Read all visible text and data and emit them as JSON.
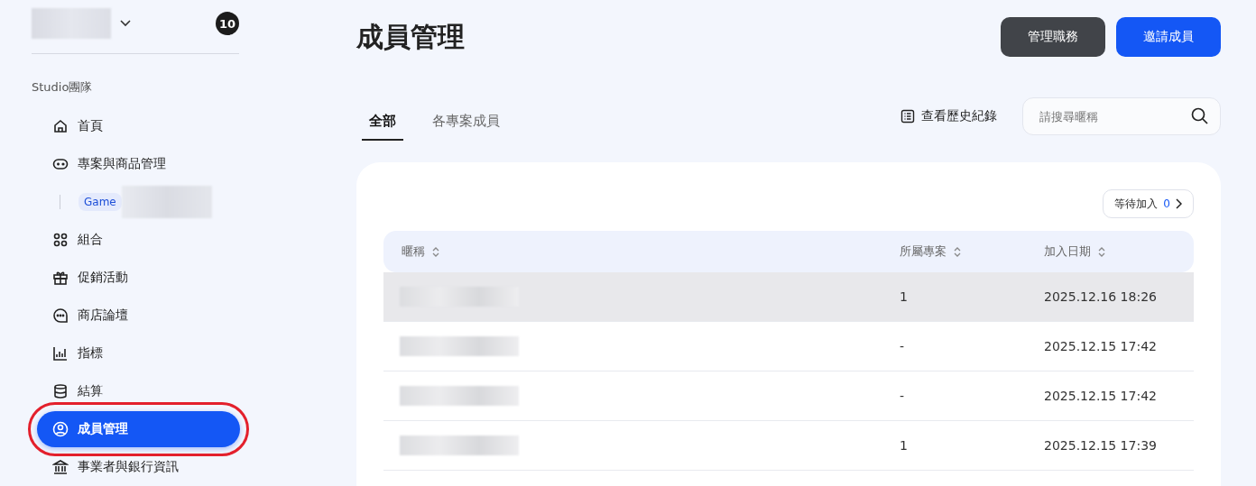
{
  "sidebar": {
    "notification_count": "10",
    "section_label": "Studio團隊",
    "items": [
      {
        "label": "首頁",
        "selected": false
      },
      {
        "label": "專案與商品管理",
        "selected": false,
        "children": [
          {
            "label": "Game",
            "selected": false
          }
        ]
      },
      {
        "label": "組合",
        "selected": false
      },
      {
        "label": "促銷活動",
        "selected": false
      },
      {
        "label": "商店論壇",
        "selected": false
      },
      {
        "label": "指標",
        "selected": false
      },
      {
        "label": "結算",
        "selected": false
      },
      {
        "label": "成員管理",
        "selected": true
      },
      {
        "label": "事業者與銀行資訊",
        "selected": false
      }
    ]
  },
  "page_title": "成員管理",
  "header_buttons": [
    {
      "label": "管理職務",
      "kind": "dark"
    },
    {
      "label": "邀請成員",
      "kind": "primary"
    }
  ],
  "tabs": [
    {
      "label": "全部",
      "selected": true
    },
    {
      "label": "各專案成員",
      "selected": false
    }
  ],
  "history_link": "查看歷史紀錄",
  "search": {
    "placeholder": "請搜尋暱稱"
  },
  "pending": {
    "label": "等待加入",
    "count": "0"
  },
  "table": {
    "columns": [
      "暱稱",
      "所屬專案",
      "加入日期"
    ],
    "rows": [
      {
        "project": "1",
        "date": "2025.12.16 18:26",
        "selected": true
      },
      {
        "project": "-",
        "date": "2025.12.15 17:42",
        "selected": false
      },
      {
        "project": "-",
        "date": "2025.12.15 17:42",
        "selected": false
      },
      {
        "project": "1",
        "date": "2025.12.15 17:39",
        "selected": false
      }
    ]
  }
}
